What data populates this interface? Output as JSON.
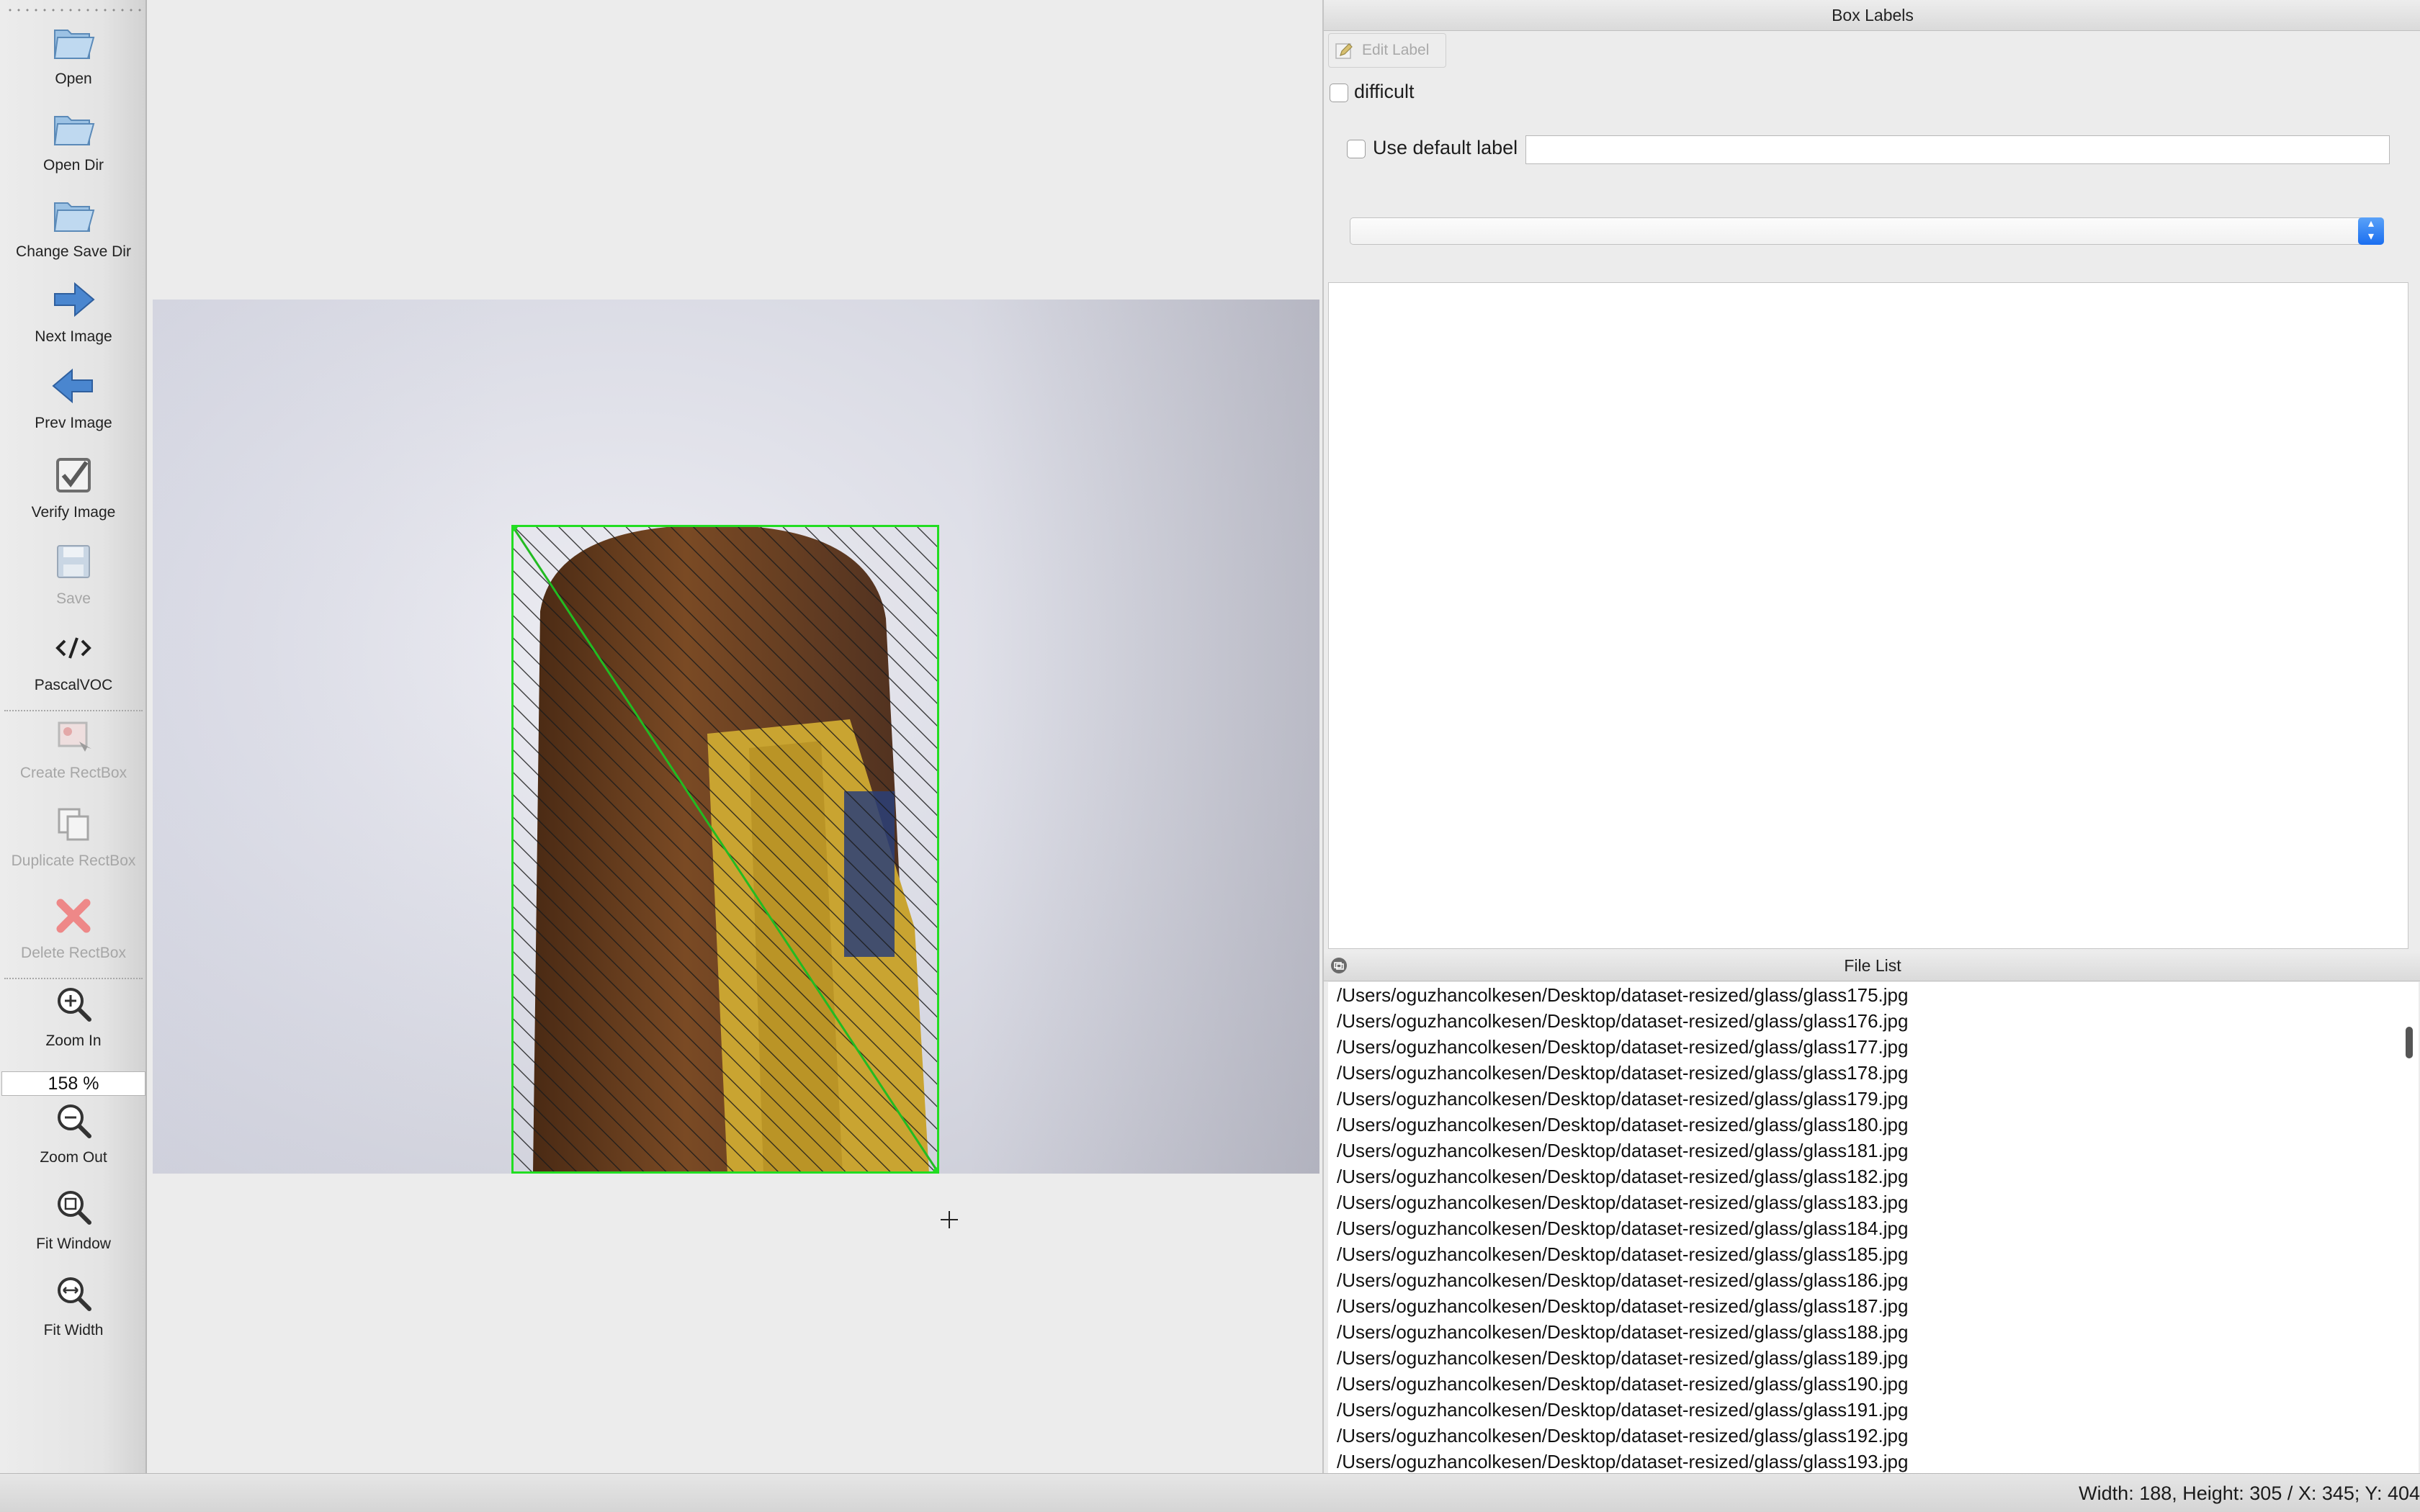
{
  "toolbar": {
    "open": "Open",
    "open_dir": "Open Dir",
    "change_save_dir": "Change Save Dir",
    "next_image": "Next Image",
    "prev_image": "Prev Image",
    "verify_image": "Verify Image",
    "save": "Save",
    "format": "PascalVOC",
    "create_rectbox": "Create RectBox",
    "duplicate_rectbox": "Duplicate RectBox",
    "delete_rectbox": "Delete RectBox",
    "zoom_in": "Zoom In",
    "zoom_value": "158 %",
    "zoom_out": "Zoom Out",
    "fit_window": "Fit Window",
    "fit_width": "Fit Width"
  },
  "box_labels": {
    "title": "Box Labels",
    "edit_label": "Edit Label",
    "difficult": "difficult",
    "difficult_checked": false,
    "use_default_label": "Use default label",
    "use_default_label_checked": false,
    "default_label_value": "",
    "label_combo_value": ""
  },
  "file_list": {
    "title": "File List",
    "items": [
      "/Users/oguzhancolkesen/Desktop/dataset-resized/glass/glass175.jpg",
      "/Users/oguzhancolkesen/Desktop/dataset-resized/glass/glass176.jpg",
      "/Users/oguzhancolkesen/Desktop/dataset-resized/glass/glass177.jpg",
      "/Users/oguzhancolkesen/Desktop/dataset-resized/glass/glass178.jpg",
      "/Users/oguzhancolkesen/Desktop/dataset-resized/glass/glass179.jpg",
      "/Users/oguzhancolkesen/Desktop/dataset-resized/glass/glass180.jpg",
      "/Users/oguzhancolkesen/Desktop/dataset-resized/glass/glass181.jpg",
      "/Users/oguzhancolkesen/Desktop/dataset-resized/glass/glass182.jpg",
      "/Users/oguzhancolkesen/Desktop/dataset-resized/glass/glass183.jpg",
      "/Users/oguzhancolkesen/Desktop/dataset-resized/glass/glass184.jpg",
      "/Users/oguzhancolkesen/Desktop/dataset-resized/glass/glass185.jpg",
      "/Users/oguzhancolkesen/Desktop/dataset-resized/glass/glass186.jpg",
      "/Users/oguzhancolkesen/Desktop/dataset-resized/glass/glass187.jpg",
      "/Users/oguzhancolkesen/Desktop/dataset-resized/glass/glass188.jpg",
      "/Users/oguzhancolkesen/Desktop/dataset-resized/glass/glass189.jpg",
      "/Users/oguzhancolkesen/Desktop/dataset-resized/glass/glass190.jpg",
      "/Users/oguzhancolkesen/Desktop/dataset-resized/glass/glass191.jpg",
      "/Users/oguzhancolkesen/Desktop/dataset-resized/glass/glass192.jpg",
      "/Users/oguzhancolkesen/Desktop/dataset-resized/glass/glass193.jpg"
    ]
  },
  "status": {
    "text": "Width: 188, Height: 305 / X: 345; Y: 404"
  },
  "colors": {
    "box_outline": "#22dd22",
    "accent": "#1a6ef0"
  }
}
